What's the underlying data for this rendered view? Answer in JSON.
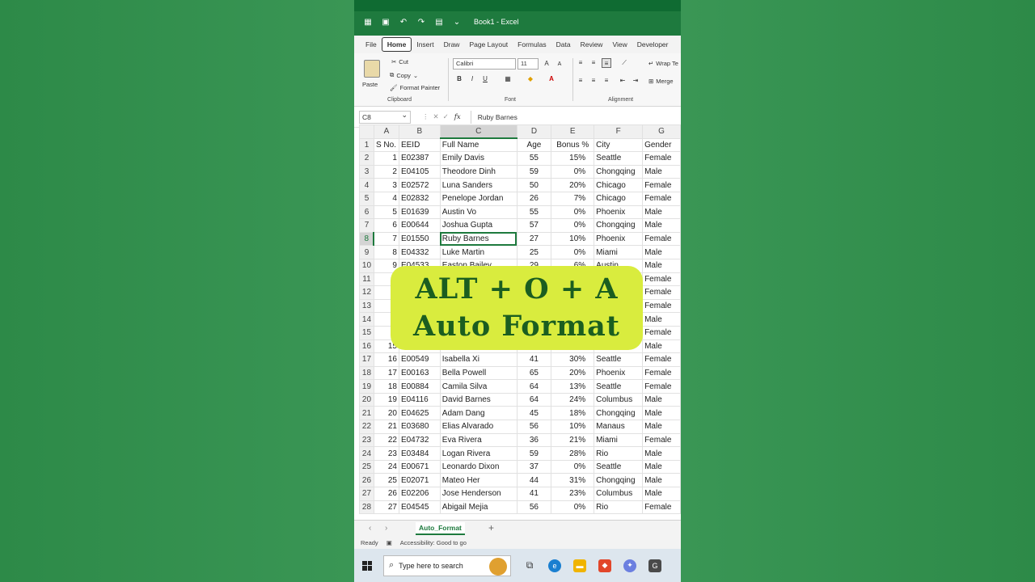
{
  "window": {
    "title": "Book1 - Excel"
  },
  "ribbon_tabs": [
    "File",
    "Home",
    "Insert",
    "Draw",
    "Page Layout",
    "Formulas",
    "Data",
    "Review",
    "View",
    "Developer"
  ],
  "clipboard": {
    "paste": "Paste",
    "cut": "Cut",
    "copy": "Copy",
    "format_painter": "Format Painter",
    "label": "Clipboard"
  },
  "font": {
    "name": "Calibri",
    "size": "11",
    "label": "Font",
    "bold": "B",
    "italic": "I",
    "underline": "U"
  },
  "alignment": {
    "wrap": "Wrap Te",
    "merge": "Merge",
    "label": "Alignment"
  },
  "formula_bar": {
    "cell_ref": "C8",
    "fx": "fx",
    "value": "Ruby Barnes"
  },
  "columns": [
    "A",
    "B",
    "C",
    "D",
    "E",
    "F",
    "G"
  ],
  "headers": [
    "S No.",
    "EEID",
    "Full Name",
    "Age",
    "Bonus %",
    "City",
    "Gender"
  ],
  "rows": [
    [
      "1",
      "E02387",
      "Emily Davis",
      "55",
      "15%",
      "Seattle",
      "Female"
    ],
    [
      "2",
      "E04105",
      "Theodore Dinh",
      "59",
      "0%",
      "Chongqing",
      "Male"
    ],
    [
      "3",
      "E02572",
      "Luna Sanders",
      "50",
      "20%",
      "Chicago",
      "Female"
    ],
    [
      "4",
      "E02832",
      "Penelope Jordan",
      "26",
      "7%",
      "Chicago",
      "Female"
    ],
    [
      "5",
      "E01639",
      "Austin Vo",
      "55",
      "0%",
      "Phoenix",
      "Male"
    ],
    [
      "6",
      "E00644",
      "Joshua Gupta",
      "57",
      "0%",
      "Chongqing",
      "Male"
    ],
    [
      "7",
      "E01550",
      "Ruby Barnes",
      "27",
      "10%",
      "Phoenix",
      "Female"
    ],
    [
      "8",
      "E04332",
      "Luke Martin",
      "25",
      "0%",
      "Miami",
      "Male"
    ],
    [
      "9",
      "E04533",
      "Easton Bailey",
      "29",
      "6%",
      "Austin",
      "Male"
    ],
    [
      "",
      "",
      "",
      "",
      "",
      "",
      "Female"
    ],
    [
      "",
      "",
      "",
      "",
      "",
      "",
      "Female"
    ],
    [
      "",
      "",
      "",
      "",
      "",
      "",
      "Female"
    ],
    [
      "",
      "",
      "",
      "",
      "",
      "",
      "Male"
    ],
    [
      "",
      "",
      "",
      "",
      "",
      "",
      "Female"
    ],
    [
      "15",
      "",
      "",
      "",
      "",
      "",
      "Male"
    ],
    [
      "16",
      "E00549",
      "Isabella Xi",
      "41",
      "30%",
      "Seattle",
      "Female"
    ],
    [
      "17",
      "E00163",
      "Bella Powell",
      "65",
      "20%",
      "Phoenix",
      "Female"
    ],
    [
      "18",
      "E00884",
      "Camila Silva",
      "64",
      "13%",
      "Seattle",
      "Female"
    ],
    [
      "19",
      "E04116",
      "David Barnes",
      "64",
      "24%",
      "Columbus",
      "Male"
    ],
    [
      "20",
      "E04625",
      "Adam Dang",
      "45",
      "18%",
      "Chongqing",
      "Male"
    ],
    [
      "21",
      "E03680",
      "Elias Alvarado",
      "56",
      "10%",
      "Manaus",
      "Male"
    ],
    [
      "22",
      "E04732",
      "Eva Rivera",
      "36",
      "21%",
      "Miami",
      "Female"
    ],
    [
      "23",
      "E03484",
      "Logan Rivera",
      "59",
      "28%",
      "Rio",
      "Male"
    ],
    [
      "24",
      "E00671",
      "Leonardo Dixon",
      "37",
      "0%",
      "Seattle",
      "Male"
    ],
    [
      "25",
      "E02071",
      "Mateo Her",
      "44",
      "31%",
      "Chongqing",
      "Male"
    ],
    [
      "26",
      "E02206",
      "Jose Henderson",
      "41",
      "23%",
      "Columbus",
      "Male"
    ],
    [
      "27",
      "E04545",
      "Abigail Mejia",
      "56",
      "0%",
      "Rio",
      "Female"
    ]
  ],
  "overlay": {
    "line1": "ALT + O + A",
    "line2": "Auto Format"
  },
  "sheet": {
    "tab": "Auto_Format",
    "add": "+"
  },
  "status": {
    "ready": "Ready",
    "accessibility": "Accessibility: Good to go"
  },
  "taskbar": {
    "search_placeholder": "Type here to search"
  },
  "colors": {
    "excel_green": "#1e7a3e",
    "overlay_bg": "#d9ec3e",
    "overlay_text": "#1b5e20"
  }
}
